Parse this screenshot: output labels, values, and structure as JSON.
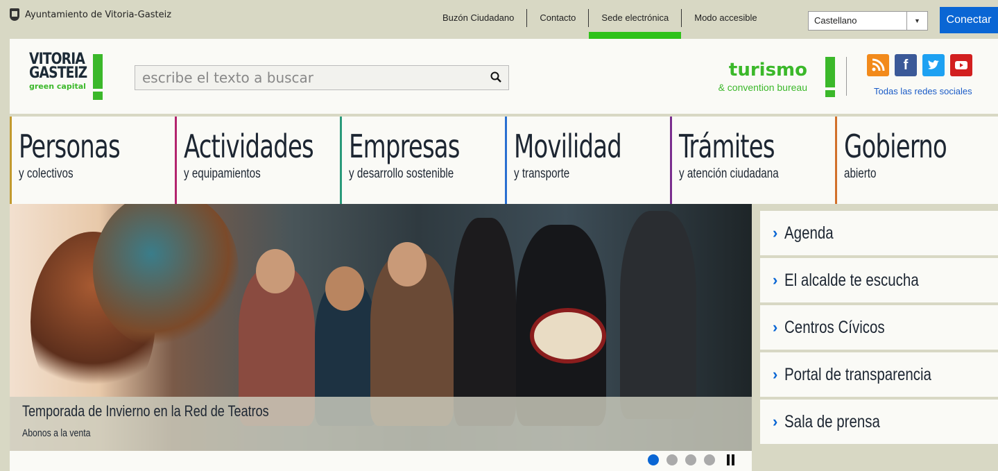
{
  "topbar": {
    "municipality": "Ayuntamiento de Vitoria-Gasteiz",
    "links": [
      {
        "label": "Buzón Ciudadano"
      },
      {
        "label": "Contacto"
      },
      {
        "label": "Sede electrónica"
      },
      {
        "label": "Modo accesible"
      }
    ],
    "language_selected": "Castellano",
    "connect_label": "Conectar"
  },
  "header": {
    "logo": {
      "line1": "VITORIA",
      "line2": "GASTEIZ",
      "line3": "green capital"
    },
    "search_placeholder": "escribe el texto a buscar",
    "tourism": {
      "line1": "turismo",
      "line2": "& convention bureau"
    },
    "social_link": "Todas las redes sociales"
  },
  "nav": [
    {
      "title": "Personas",
      "subtitle": "y colectivos",
      "color": "#c29a2e"
    },
    {
      "title": "Actividades",
      "subtitle": "y equipamientos",
      "color": "#b3246e"
    },
    {
      "title": "Empresas",
      "subtitle": "y desarrollo sostenible",
      "color": "#2a9a7a"
    },
    {
      "title": "Movilidad",
      "subtitle": "y transporte",
      "color": "#2a6fd1"
    },
    {
      "title": "Trámites",
      "subtitle": "y atención ciudadana",
      "color": "#7a2e8e"
    },
    {
      "title": "Gobierno",
      "subtitle": "abierto",
      "color": "#d2702a"
    }
  ],
  "hero": {
    "title": "Temporada de Invierno en la Red de Teatros",
    "subtitle": "Abonos a la venta"
  },
  "side_menu": [
    {
      "label": "Agenda"
    },
    {
      "label": "El alcalde te escucha"
    },
    {
      "label": "Centros Cívicos"
    },
    {
      "label": "Portal de transparencia"
    },
    {
      "label": "Sala de prensa"
    }
  ],
  "carousel": {
    "slides": 4,
    "active": 1
  },
  "colors": {
    "accent": "#0a66d4",
    "brand_green": "#3bb82a",
    "background": "#d8d8c4"
  }
}
